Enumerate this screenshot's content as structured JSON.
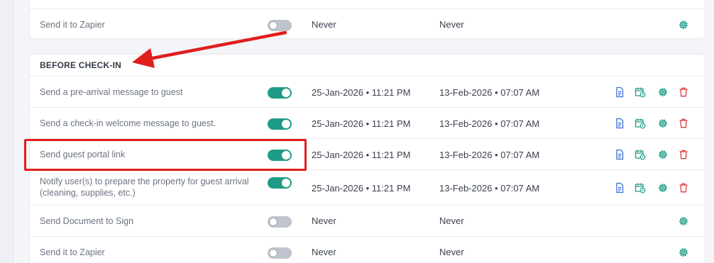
{
  "top_card": {
    "rows": [
      {
        "label": "Send it to Zapier",
        "enabled": false,
        "date1": "Never",
        "date2": "Never"
      }
    ]
  },
  "before_checkin": {
    "title": "BEFORE CHECK-IN",
    "rows": [
      {
        "label": "Send a pre-arrival message to guest",
        "enabled": true,
        "date1": "25-Jan-2026 • 11:21 PM",
        "date2": "13-Feb-2026 • 07:07 AM"
      },
      {
        "label": "Send a check-in welcome message to guest.",
        "enabled": true,
        "date1": "25-Jan-2026 • 11:21 PM",
        "date2": "13-Feb-2026 • 07:07 AM"
      },
      {
        "label": "Send guest portal link",
        "enabled": true,
        "date1": "25-Jan-2026 • 11:21 PM",
        "date2": "13-Feb-2026 • 07:07 AM"
      },
      {
        "label": "Notify user(s) to prepare the property for guest arrival (cleaning, supplies, etc.)",
        "enabled": true,
        "date1": "25-Jan-2026 • 11:21 PM",
        "date2": "13-Feb-2026 • 07:07 AM"
      },
      {
        "label": "Send Document to Sign",
        "enabled": false,
        "date1": "Never",
        "date2": "Never"
      },
      {
        "label": "Send it to Zapier",
        "enabled": false,
        "date1": "Never",
        "date2": "Never"
      }
    ]
  },
  "icons": {
    "document": "document-icon",
    "calendar": "calendar-clock-icon",
    "settings": "gear-icon",
    "delete": "trash-icon"
  },
  "colors": {
    "toggle_on": "#1e9b86",
    "toggle_off": "#bfc4cc",
    "doc_icon": "#3b6fd6",
    "settings_icon": "#1e9b86",
    "delete_icon": "#e03b3b",
    "annotation": "#e01e1e"
  }
}
